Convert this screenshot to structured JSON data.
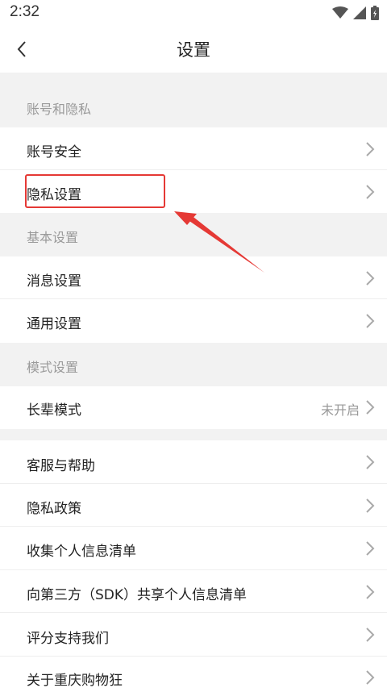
{
  "status_bar": {
    "time": "2:32",
    "icons": [
      "wifi-icon",
      "signal-icon",
      "battery-icon"
    ]
  },
  "nav": {
    "title": "设置",
    "back_icon": "chevron-left-icon"
  },
  "sections": [
    {
      "header": "账号和隐私",
      "items": [
        {
          "label": "账号安全"
        },
        {
          "label": "隐私设置"
        }
      ]
    },
    {
      "header": "基本设置",
      "items": [
        {
          "label": "消息设置"
        },
        {
          "label": "通用设置"
        }
      ]
    },
    {
      "header": "模式设置",
      "items": [
        {
          "label": "长辈模式",
          "value": "未开启"
        }
      ]
    }
  ],
  "more_items": [
    {
      "label": "客服与帮助"
    },
    {
      "label": "隐私政策"
    },
    {
      "label": "收集个人信息清单"
    },
    {
      "label": "向第三方（SDK）共享个人信息清单"
    },
    {
      "label": "评分支持我们"
    },
    {
      "label": "关于重庆购物狂"
    }
  ],
  "colors": {
    "accent_annotation": "#e53935",
    "section_background": "#f2f2f2",
    "text_primary": "#222222",
    "text_secondary": "#999999"
  }
}
